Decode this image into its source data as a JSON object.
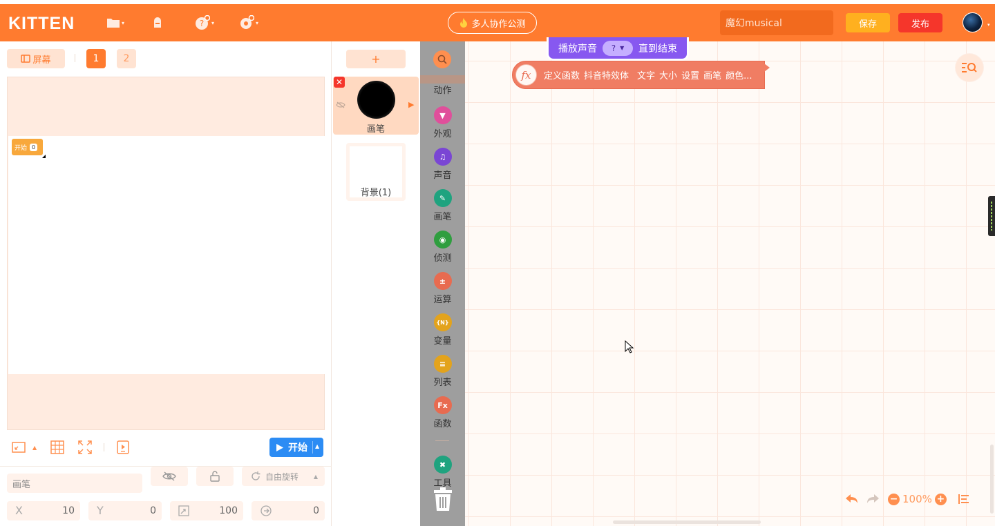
{
  "header": {
    "logo": "KITTEN",
    "icons": [
      "folder-icon",
      "backpack-icon",
      "help-icon",
      "settings-icon"
    ],
    "collab_label": "多人协作公测",
    "project_title": "魔幻musical",
    "save_label": "保存",
    "publish_label": "发布"
  },
  "stage": {
    "screen_label": "屏幕",
    "pages": [
      "1",
      "2"
    ],
    "active_page": "1",
    "start_chip_label": "开始",
    "start_chip_value": "0",
    "run_label": "开始"
  },
  "sprite_props": {
    "name": "画笔",
    "rotation_label": "自由旋转",
    "x_label": "X",
    "x_value": "10",
    "y_label": "Y",
    "y_value": "0",
    "size_value": "100",
    "direction_value": "0"
  },
  "sprites": {
    "add_label": "+",
    "items": [
      {
        "name": "画笔",
        "selected": true
      }
    ],
    "background_label": "背景(1)"
  },
  "categories": [
    {
      "label": "动作",
      "color": "#ff7b2f",
      "icon": "motion-icon"
    },
    {
      "label": "外观",
      "color": "#e04f9b",
      "icon": "shirt-icon"
    },
    {
      "label": "声音",
      "color": "#7a46d4",
      "icon": "music-note-icon"
    },
    {
      "label": "画笔",
      "color": "#1fa37f",
      "icon": "pen-icon"
    },
    {
      "label": "侦测",
      "color": "#2f9e3f",
      "icon": "sensing-icon"
    },
    {
      "label": "运算",
      "color": "#e86b50",
      "icon": "operator-icon"
    },
    {
      "label": "变量",
      "color": "#e3a31c",
      "icon": "variable-icon"
    },
    {
      "label": "列表",
      "color": "#e3a31c",
      "icon": "list-icon"
    },
    {
      "label": "函数",
      "color": "#e86b50",
      "icon": "function-icon"
    },
    {
      "label": "工具",
      "color": "#1fa37f",
      "icon": "tools-icon"
    }
  ],
  "workspace": {
    "sound_block": {
      "prefix": "播放声音",
      "value": "?",
      "suffix": "直到结束"
    },
    "function_block": {
      "fx_label": "fx",
      "words": [
        "定义函数",
        "抖音特效体",
        "文字",
        "大小",
        "设置",
        "画笔",
        "颜色..."
      ]
    },
    "zoom": "100%"
  }
}
